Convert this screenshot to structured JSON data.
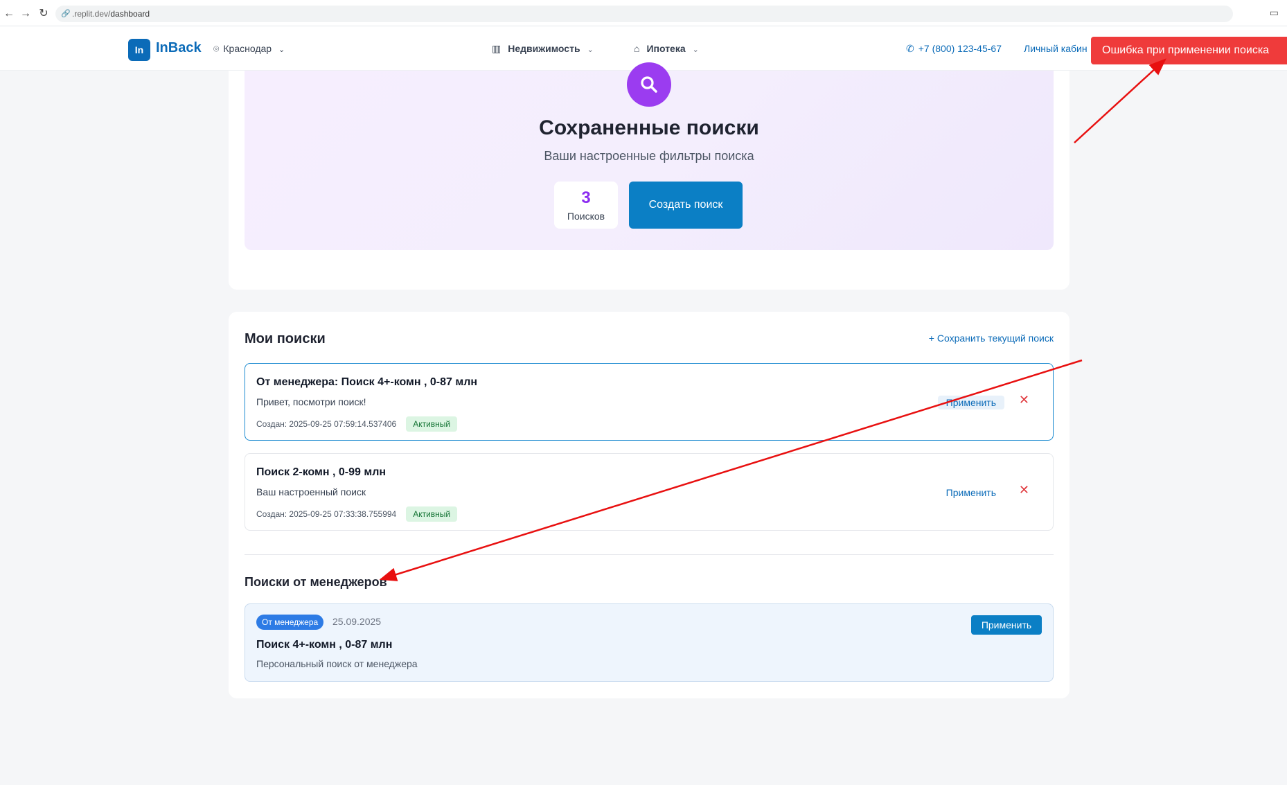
{
  "browser": {
    "url_prefix": ".replit.dev/",
    "url_path": "dashboard"
  },
  "header": {
    "logo_mark": "In",
    "logo_text": "InBack",
    "city": "Краснодар",
    "menu": [
      {
        "label": "Недвижимость",
        "icon": "building-icon"
      },
      {
        "label": "Ипотека",
        "icon": "home-icon"
      }
    ],
    "phone": "+7 (800) 123-45-67",
    "cabinet": "Личный кабин"
  },
  "toast": {
    "text": "Ошибка при применении поиска",
    "color": "#ef3b3b"
  },
  "hero": {
    "title": "Сохраненные поиски",
    "subtitle": "Ваши настроенные фильтры поиска",
    "count": "3",
    "count_label": "Поисков",
    "create_button": "Создать поиск"
  },
  "my_searches": {
    "title": "Мои поиски",
    "save_link": "+ Сохранить текущий поиск",
    "items": [
      {
        "title": "От менеджера: Поиск 4+-комн , 0-87 млн",
        "description": "Привет, посмотри поиск!",
        "created": "Создан: 2025-09-25 07:59:14.537406",
        "status": "Активный",
        "apply": "Применить",
        "delete": "✕"
      },
      {
        "title": "Поиск 2-комн , 0-99 млн",
        "description": "Ваш настроенный поиск",
        "created": "Создан: 2025-09-25 07:33:38.755994",
        "status": "Активный",
        "apply": "Применить",
        "delete": "✕"
      }
    ]
  },
  "manager_searches": {
    "title": "Поиски от менеджеров",
    "items": [
      {
        "badge": "От менеджера",
        "date": "25.09.2025",
        "title": "Поиск 4+-комн , 0-87 млн",
        "description": "Персональный поиск от менеджера",
        "apply": "Применить"
      }
    ]
  },
  "colors": {
    "brand": "#0b6bb8",
    "accent_purple": "#9b3cf0",
    "error": "#ef3b3b"
  }
}
